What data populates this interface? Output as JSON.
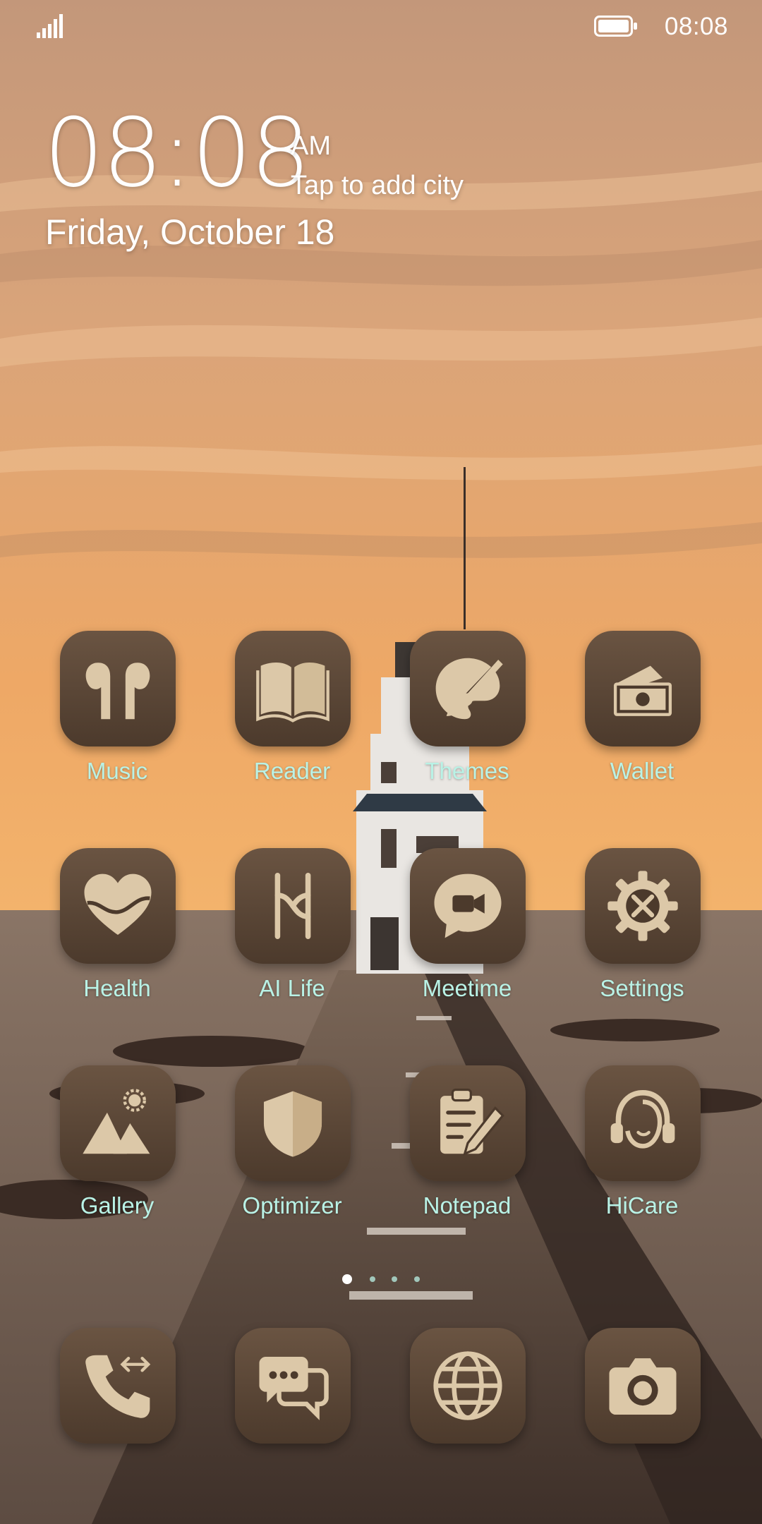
{
  "status_bar": {
    "time": "08:08",
    "icons": [
      "signal-icon",
      "battery-icon"
    ]
  },
  "clock_widget": {
    "time": "08:08",
    "am_pm": "AM",
    "city_prompt": "Tap to add city",
    "date": "Friday, October 18"
  },
  "apps": [
    {
      "label": "Music",
      "icon": "earbuds-icon"
    },
    {
      "label": "Reader",
      "icon": "open-book-icon"
    },
    {
      "label": "Themes",
      "icon": "paintbrush-icon"
    },
    {
      "label": "Wallet",
      "icon": "wallet-icon"
    },
    {
      "label": "Health",
      "icon": "heart-icon"
    },
    {
      "label": "AI Life",
      "icon": "ai-life-icon"
    },
    {
      "label": "Meetime",
      "icon": "video-chat-icon"
    },
    {
      "label": "Settings",
      "icon": "gear-icon"
    },
    {
      "label": "Gallery",
      "icon": "mountain-photo-icon"
    },
    {
      "label": "Optimizer",
      "icon": "shield-icon"
    },
    {
      "label": "Notepad",
      "icon": "clipboard-pen-icon"
    },
    {
      "label": "HiCare",
      "icon": "headset-icon"
    }
  ],
  "page_indicator": {
    "pages": 4,
    "active_page": 1
  },
  "dock": [
    {
      "icon": "phone-icon"
    },
    {
      "icon": "messages-icon"
    },
    {
      "icon": "browser-globe-icon"
    },
    {
      "icon": "camera-icon"
    }
  ],
  "colors": {
    "label_text": "#b9f2e6",
    "tile_top": "#6a5442",
    "tile_bottom": "#4c3a2c",
    "glyph": "#dcc8a8",
    "sky_top": "#c79870",
    "sky_horizon": "#f0ab62"
  }
}
